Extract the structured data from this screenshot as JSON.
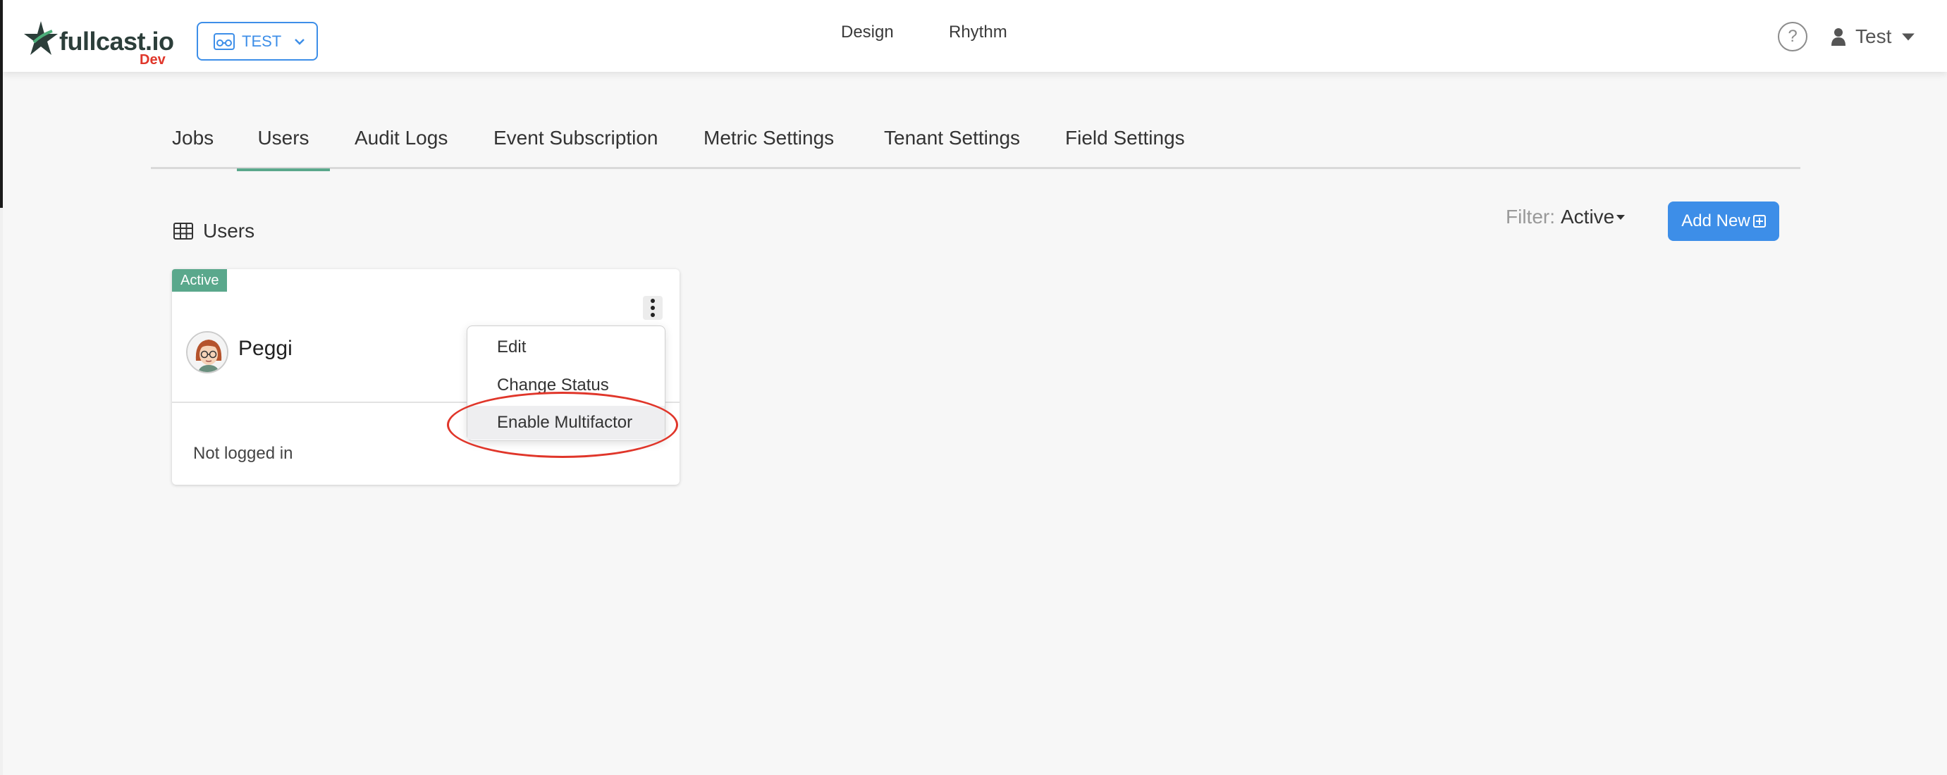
{
  "brand": {
    "name": "fullcast.io",
    "env_label": "Dev"
  },
  "env_selector": {
    "label": "TEST"
  },
  "nav": {
    "design": "Design",
    "rhythm": "Rhythm"
  },
  "help": {
    "glyph": "?"
  },
  "user_menu": {
    "name": "Test"
  },
  "tabs": [
    {
      "label": "Jobs"
    },
    {
      "label": "Users",
      "active": true
    },
    {
      "label": "Audit Logs"
    },
    {
      "label": "Event Subscription"
    },
    {
      "label": "Metric Settings"
    },
    {
      "label": "Tenant Settings"
    },
    {
      "label": "Field Settings"
    }
  ],
  "section": {
    "title": "Users"
  },
  "filter": {
    "label": "Filter:",
    "value": "Active"
  },
  "add_button": {
    "label": "Add New"
  },
  "user_card": {
    "status_badge": "Active",
    "name": "Peggi",
    "login_status": "Not logged in"
  },
  "card_menu": {
    "items": [
      {
        "label": "Edit"
      },
      {
        "label": "Change Status"
      },
      {
        "label": "Enable Multifactor",
        "highlighted": true
      }
    ]
  },
  "colors": {
    "accent_blue": "#3d8ee8",
    "active_green": "#5aa88c",
    "annotation_red": "#e0362a",
    "brand_dark": "#2c3e3a"
  }
}
